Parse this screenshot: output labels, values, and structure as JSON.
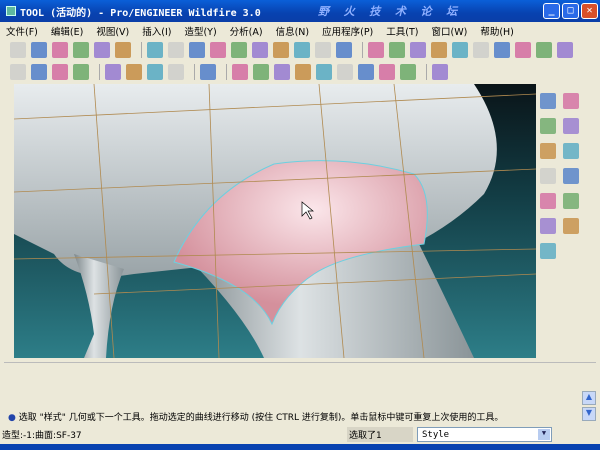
{
  "window": {
    "title": "TOOL (活动的) - Pro/ENGINEER Wildfire 3.0",
    "watermark": "野 火 技 术 论 坛"
  },
  "menu": [
    "文件(F)",
    "编辑(E)",
    "视图(V)",
    "插入(I)",
    "造型(Y)",
    "分析(A)",
    "信息(N)",
    "应用程序(P)",
    "工具(T)",
    "窗口(W)",
    "帮助(H)"
  ],
  "toolbar1": [
    "new",
    "open",
    "save",
    "print",
    "copy-window",
    "paste-window",
    "undo",
    "redo",
    "regenerate",
    "cut",
    "copy",
    "paste",
    "paste-special",
    "model-tree",
    "find",
    "select-box",
    "view-manager",
    "spin-center",
    "zoom-to-fit",
    "zoom-in",
    "zoom-out",
    "refit",
    "orient",
    "saved-views",
    "layers",
    "appearance"
  ],
  "toolbar2": [
    "wireframe",
    "hidden-line",
    "no-hidden",
    "shading",
    "datum-plane",
    "datum-axis",
    "datum-point",
    "csys",
    "style-settings",
    "curve",
    "surface",
    "curve-edit",
    "surface-connect",
    "surface-trim",
    "drop-curve",
    "curve-from-cos",
    "trim",
    "delete",
    "whats-this"
  ],
  "right_toolbar": [
    "select",
    "grid",
    "plane",
    "curve",
    "curve-edit",
    "circle",
    "arc",
    "drop",
    "surface",
    "trim",
    "intersect",
    "offset",
    "finish"
  ],
  "message": "选取 \"样式\" 几何或下一个工具。拖动选定的曲线进行移动 (按住 CTRL 进行复制)。单击鼠标中键可重复上次使用的工具。",
  "status": {
    "left": "造型:-1:曲面:SF-37",
    "selected": "选取了1",
    "filter": "Style"
  },
  "colors": {
    "titlebar": "#0842b0",
    "patch": "#e0a0aa",
    "viewport_bg": "#123c44"
  }
}
